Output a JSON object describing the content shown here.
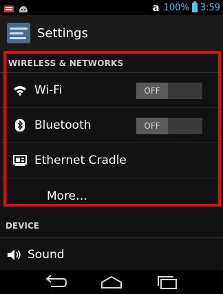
{
  "status_bar": {
    "carrier_mark": "a",
    "battery_percent": "100%",
    "time": "3:59",
    "icons": [
      "mail-icon",
      "android-icon",
      "battery-icon"
    ]
  },
  "action_bar": {
    "title": "Settings",
    "icon": "settings-sliders-icon"
  },
  "wireless_section": {
    "header": "WIRELESS & NETWORKS",
    "items": [
      {
        "label": "Wi-Fi",
        "icon": "wifi-icon",
        "toggle": "OFF"
      },
      {
        "label": "Bluetooth",
        "icon": "bluetooth-icon",
        "toggle": "OFF"
      },
      {
        "label": "Ethernet Cradle",
        "icon": "ethernet-cradle-icon"
      },
      {
        "label": "More…"
      }
    ]
  },
  "device_section": {
    "header": "DEVICE",
    "items": [
      {
        "label": "Sound",
        "icon": "speaker-icon"
      }
    ]
  },
  "nav_bar": {
    "buttons": [
      "back-icon",
      "home-icon",
      "recents-icon"
    ]
  },
  "colors": {
    "highlight": "#e01010",
    "accent": "#4fc3f7"
  }
}
